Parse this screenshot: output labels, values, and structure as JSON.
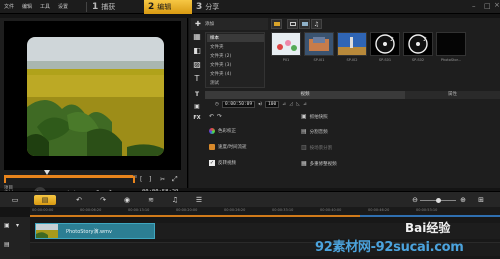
{
  "menu": {
    "items": [
      "文件",
      "编辑",
      "工具",
      "设置"
    ]
  },
  "steps": [
    {
      "num": "1",
      "label": "捕获"
    },
    {
      "num": "2",
      "label": "编辑"
    },
    {
      "num": "3",
      "label": "分享"
    }
  ],
  "preview": {
    "project_label": "项目",
    "clip_label": "素材",
    "timecode": "00:00:58:29",
    "progress_percent": 97
  },
  "library": {
    "add_label": "添加",
    "folders": [
      "样本",
      "文件夹",
      "文件夹 (2)",
      "文件夹 (3)",
      "文件夹 (4)",
      "测试"
    ],
    "thumbnails": [
      "P01",
      "SP-I01",
      "SP-I02",
      "SP-S01",
      "SP-S02",
      "PhotoStor..."
    ]
  },
  "options": {
    "tab_video": "视频",
    "tab_attr": "属性",
    "duration": "0:00:50:09",
    "volume": "100",
    "left_items": [
      "色彩校正",
      "速度/时间流逝",
      "反转视频"
    ],
    "right_items": [
      "抓拍快照",
      "分割音频",
      "按场景分割",
      "多重修整视频"
    ]
  },
  "timeline": {
    "ticks": [
      "00:00:00:00",
      "00:00:06:20",
      "00:00:13:10",
      "00:00:20:00",
      "00:00:26:20",
      "00:00:33:10",
      "00:00:40:00",
      "00:00:46:20",
      "00:00:53:10"
    ],
    "clip_name": "PhotoStory演.wmv"
  },
  "watermark": {
    "site": "92素材网-92sucai.com",
    "brand": "Bai经验"
  },
  "colors": {
    "accent": "#e8a21f",
    "clip": "#2c7e93",
    "progress": "#d07a1a"
  }
}
